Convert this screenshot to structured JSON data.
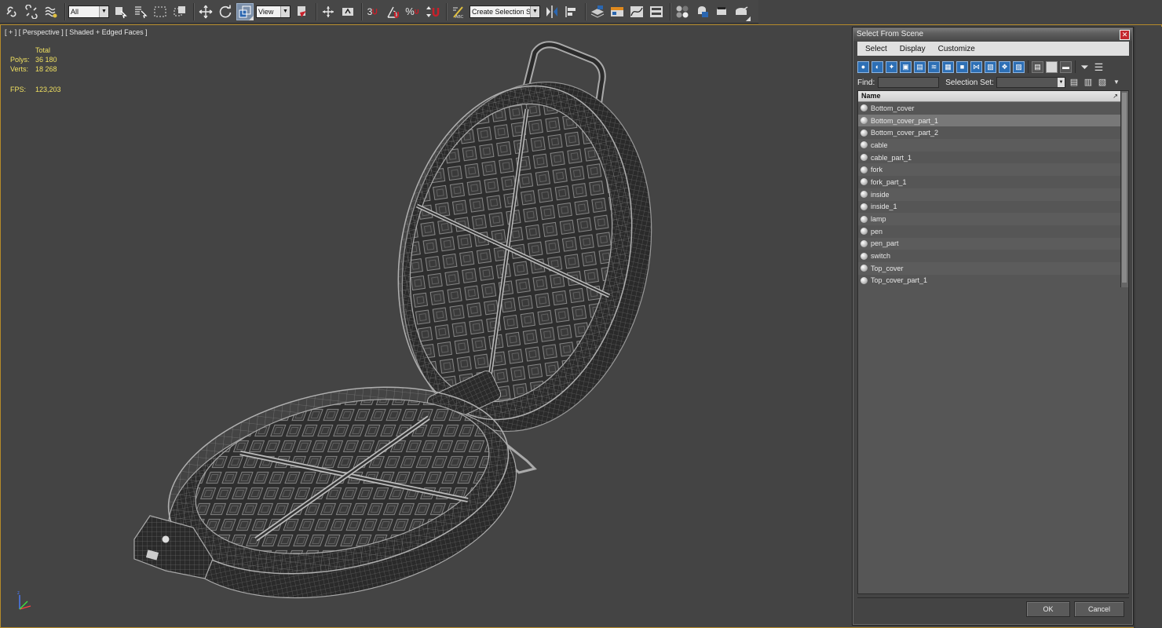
{
  "toolbar": {
    "filter_select": "All",
    "ref_coord_select": "View",
    "named_selection_select": "Create Selection Se",
    "snap_label": "3",
    "percent_label": "%",
    "icons": [
      "link-icon",
      "unlink-icon",
      "bind-spacewarp-icon",
      "select-object-icon",
      "select-by-name-icon",
      "rect-region-icon",
      "window-crossing-icon",
      "move-icon",
      "rotate-icon",
      "scale-icon",
      "pivot-icon",
      "select-manipulate-icon",
      "keyboard-shortcut-icon",
      "snap-3d-icon",
      "angle-snap-icon",
      "percent-snap-icon",
      "spinner-snap-icon",
      "edit-named-sel-icon",
      "mirror-icon",
      "align-icon",
      "layer-manager-icon",
      "ribbon-icon",
      "curve-editor-icon",
      "schematic-view-icon",
      "material-editor-icon",
      "render-setup-icon",
      "rendered-frame-icon",
      "render-production-icon"
    ]
  },
  "viewport": {
    "label": "[ + ] [ Perspective ] [ Shaded + Edged Faces ]",
    "stats": {
      "header": "Total",
      "polys_label": "Polys:",
      "polys_value": "36 180",
      "verts_label": "Verts:",
      "verts_value": "18 268",
      "fps_label": "FPS:",
      "fps_value": "123,203"
    },
    "active_border_color": "#b58b2a",
    "background_color": "#444444"
  },
  "dialog": {
    "title": "Select From Scene",
    "menu": [
      "Select",
      "Display",
      "Customize"
    ],
    "find_label": "Find:",
    "find_value": "",
    "selection_set_label": "Selection Set:",
    "selection_set_value": "",
    "list_header": "Name",
    "items": [
      {
        "name": "Bottom_cover",
        "selected": false
      },
      {
        "name": "Bottom_cover_part_1",
        "selected": true
      },
      {
        "name": "Bottom_cover_part_2",
        "selected": false
      },
      {
        "name": "cable",
        "selected": false
      },
      {
        "name": "cable_part_1",
        "selected": false
      },
      {
        "name": "fork",
        "selected": false
      },
      {
        "name": "fork_part_1",
        "selected": false
      },
      {
        "name": "inside",
        "selected": false
      },
      {
        "name": "inside_1",
        "selected": false
      },
      {
        "name": "lamp",
        "selected": false
      },
      {
        "name": "pen",
        "selected": false
      },
      {
        "name": "pen_part",
        "selected": false
      },
      {
        "name": "switch",
        "selected": false
      },
      {
        "name": "Top_cover",
        "selected": false
      },
      {
        "name": "Top_cover_part_1",
        "selected": false
      }
    ],
    "ok_label": "OK",
    "cancel_label": "Cancel"
  }
}
